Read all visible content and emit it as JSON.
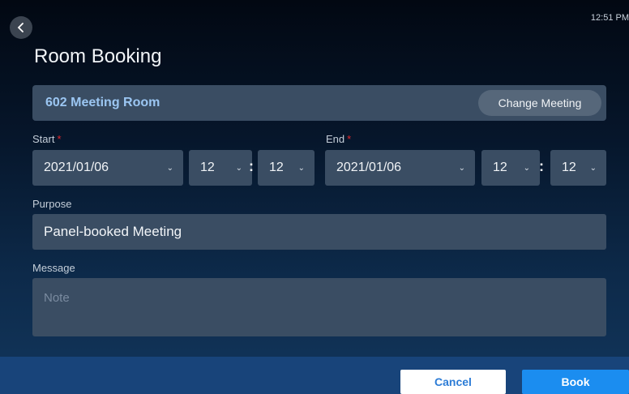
{
  "status": {
    "time": "12:51 PM"
  },
  "header": {
    "back_icon": "chevron-left-icon",
    "title": "Room Booking"
  },
  "room": {
    "name": "602 Meeting Room",
    "change_label": "Change Meeting"
  },
  "start": {
    "label": "Start",
    "required_mark": "*",
    "date": "2021/01/06",
    "hour": "12",
    "minute": "12"
  },
  "end": {
    "label": "End",
    "required_mark": "*",
    "date": "2021/01/06",
    "hour": "12",
    "minute": "12"
  },
  "time_separator": ":",
  "purpose": {
    "label": "Purpose",
    "value": "Panel-booked Meeting"
  },
  "message": {
    "label": "Message",
    "placeholder": "Note"
  },
  "footer": {
    "cancel_label": "Cancel",
    "book_label": "Book"
  },
  "colors": {
    "accent": "#1b8df0",
    "required": "#e0262c",
    "field_bg": "#3a4d63",
    "footer_bg": "#18447a"
  }
}
